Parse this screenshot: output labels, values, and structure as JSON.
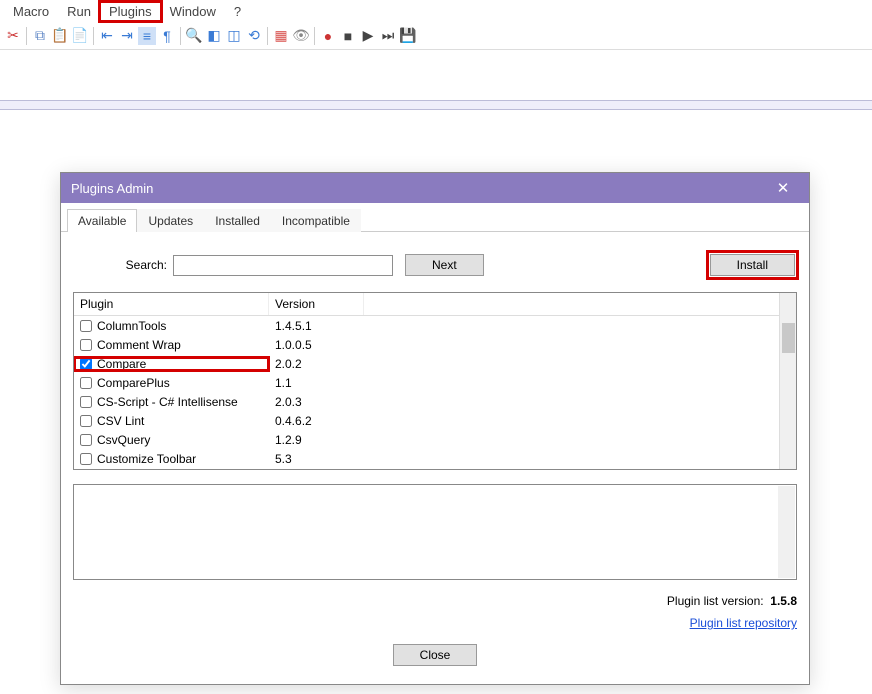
{
  "menubar": {
    "items": [
      "Macro",
      "Run",
      "Plugins",
      "Window",
      "?"
    ],
    "highlighted_index": 2
  },
  "dialog": {
    "title": "Plugins Admin",
    "tabs": [
      "Available",
      "Updates",
      "Installed",
      "Incompatible"
    ],
    "active_tab_index": 0,
    "search_label": "Search:",
    "search_value": "",
    "next_label": "Next",
    "install_label": "Install",
    "columns": {
      "plugin": "Plugin",
      "version": "Version"
    },
    "rows": [
      {
        "name": "ColumnTools",
        "version": "1.4.5.1",
        "checked": false
      },
      {
        "name": "Comment Wrap",
        "version": "1.0.0.5",
        "checked": false
      },
      {
        "name": "Compare",
        "version": "2.0.2",
        "checked": true,
        "highlight": true
      },
      {
        "name": "ComparePlus",
        "version": "1.1",
        "checked": false
      },
      {
        "name": "CS-Script - C# Intellisense",
        "version": "2.0.3",
        "checked": false
      },
      {
        "name": "CSV Lint",
        "version": "0.4.6.2",
        "checked": false
      },
      {
        "name": "CsvQuery",
        "version": "1.2.9",
        "checked": false
      },
      {
        "name": "Customize Toolbar",
        "version": "5.3",
        "checked": false
      }
    ],
    "version_label": "Plugin list version:",
    "version_value": "1.5.8",
    "repo_link": "Plugin list repository",
    "close_label": "Close"
  }
}
